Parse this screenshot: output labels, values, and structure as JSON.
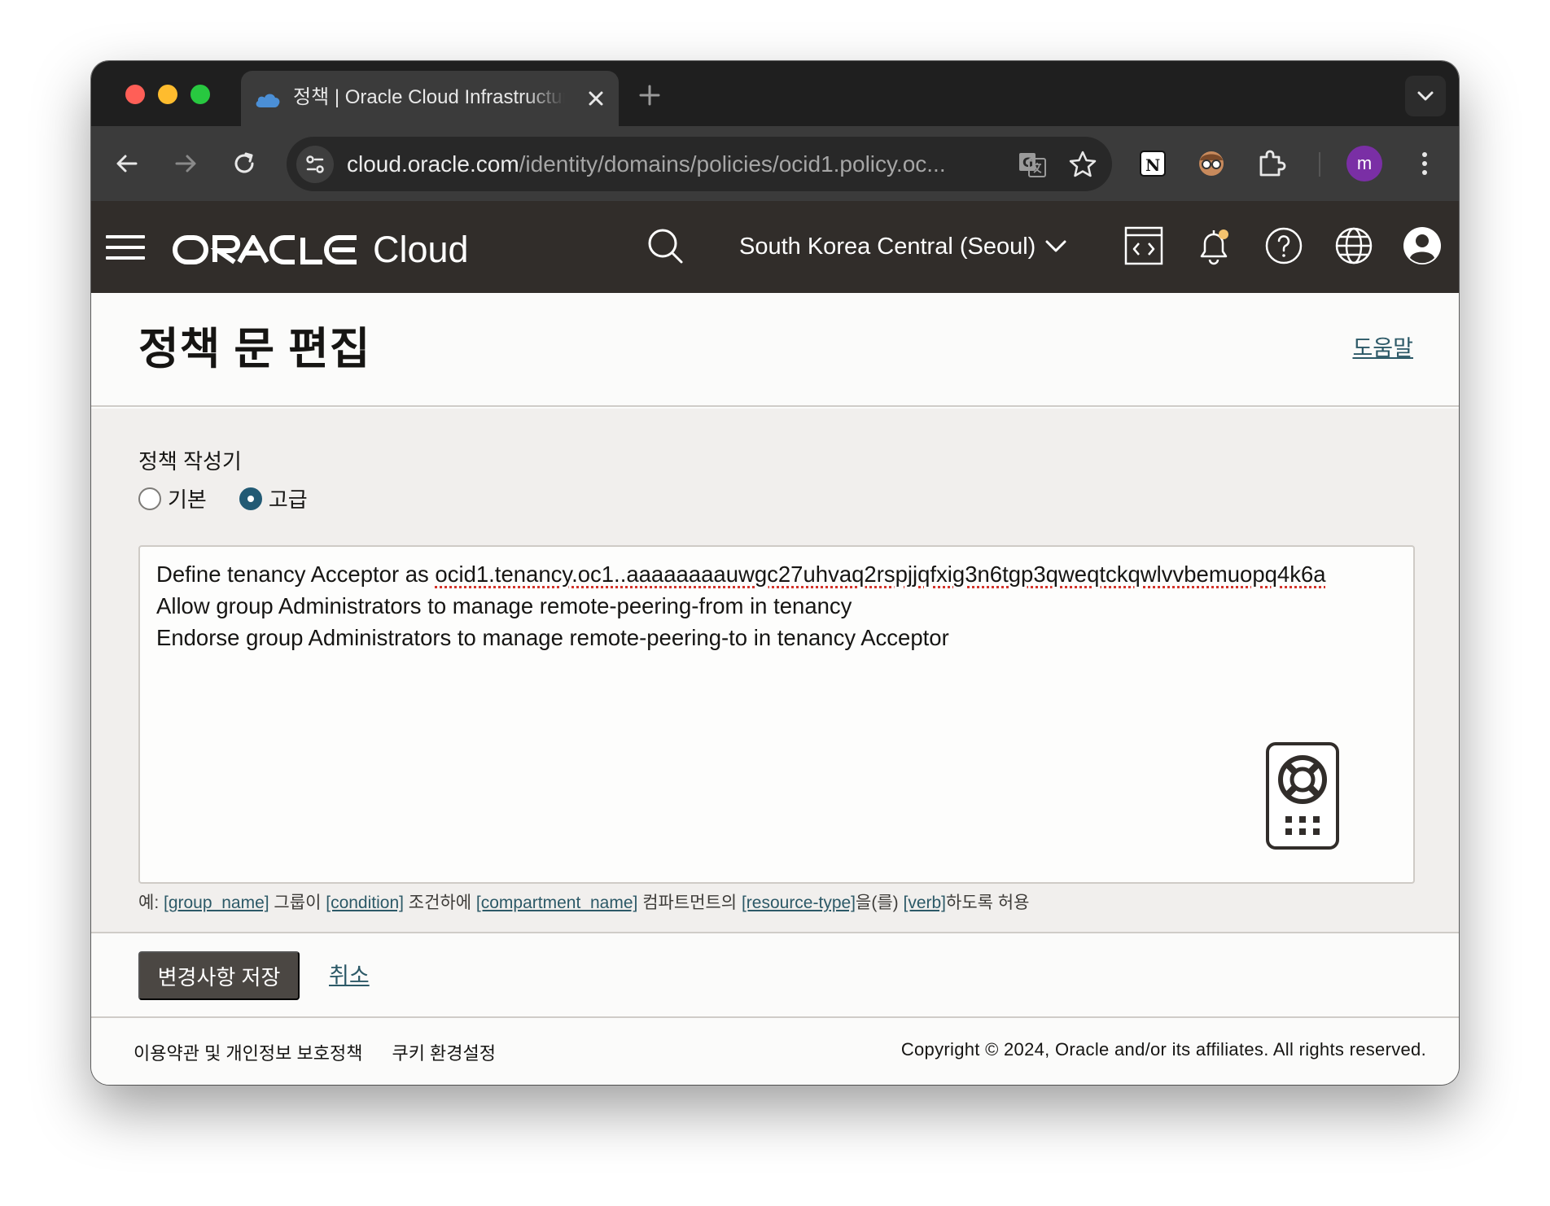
{
  "browser": {
    "tab_title": "정책 | Oracle Cloud Infrastructure",
    "url_domain": "cloud.oracle.com",
    "url_path": "/identity/domains/policies/ocid1.policy.oc...",
    "profile_initial": "m"
  },
  "header": {
    "brand_cloud": "Cloud",
    "region": "South Korea Central (Seoul)"
  },
  "page": {
    "title": "정책 문 편집",
    "help_link": "도움말"
  },
  "builder": {
    "label": "정책 작성기",
    "options": [
      {
        "label": "기본",
        "checked": false
      },
      {
        "label": "고급",
        "checked": true
      }
    ]
  },
  "editor": {
    "line1_prefix": "Define tenancy Acceptor as ",
    "line1_ocid": "ocid1.tenancy.oc1..aaaaaaaauwgc27uhvaq2rspjjqfxig3n6tgp3qweqtckqwlvvbemuopq4k6a",
    "line2": "Allow group Administrators to manage remote-peering-from in tenancy",
    "line3": "Endorse group Administrators to manage remote-peering-to in tenancy Acceptor"
  },
  "hint": {
    "prefix": "예: ",
    "group_name": "[group_name]",
    "t1": " 그룹이 ",
    "condition": "[condition]",
    "t2": " 조건하에 ",
    "compartment_name": "[compartment_name]",
    "t3": " 컴파트먼트의 ",
    "resource_type": "[resource-type]",
    "t4": "을(를) ",
    "verb": "[verb]",
    "t5": "하도록 허용"
  },
  "actions": {
    "save": "변경사항 저장",
    "cancel": "취소"
  },
  "footer": {
    "terms": "이용약관 및 개인정보 보호정책",
    "cookies": "쿠키 환경설정",
    "copyright": "Copyright © 2024, Oracle and/or its affiliates. All rights reserved."
  },
  "colors": {
    "header_bg": "#312d2a",
    "link": "#2c5967",
    "radio_selected": "#225a74",
    "save_button": "#4b4743"
  }
}
